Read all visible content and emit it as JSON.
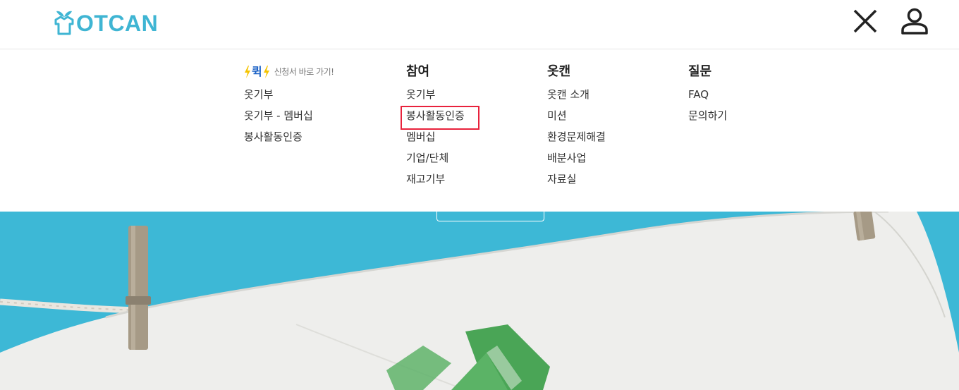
{
  "header": {
    "logo_text": "OTCAN",
    "close_icon": "close-icon",
    "user_icon": "user-icon"
  },
  "menu": {
    "quick": {
      "word": "퀵",
      "subtitle": "신청서 바로 가기!",
      "items": [
        "옷기부",
        "옷기부 - 멤버십",
        "봉사활동인증"
      ]
    },
    "participation": {
      "title": "참여",
      "items": [
        "옷기부",
        "봉사활동인증",
        "멤버십",
        "기업/단체",
        "재고기부"
      ]
    },
    "otcan": {
      "title": "옷캔",
      "items": [
        "옷캔 소개",
        "미션",
        "환경문제해결",
        "배분사업",
        "자료실"
      ]
    },
    "question": {
      "title": "질문",
      "items": [
        "FAQ",
        "문의하기"
      ]
    }
  },
  "colors": {
    "brand": "#3fb5d3",
    "hero_bg": "#3db8d6",
    "quick_blue": "#1e63c6",
    "bolt_yellow": "#f5c400",
    "highlight_red": "#e8223c"
  }
}
